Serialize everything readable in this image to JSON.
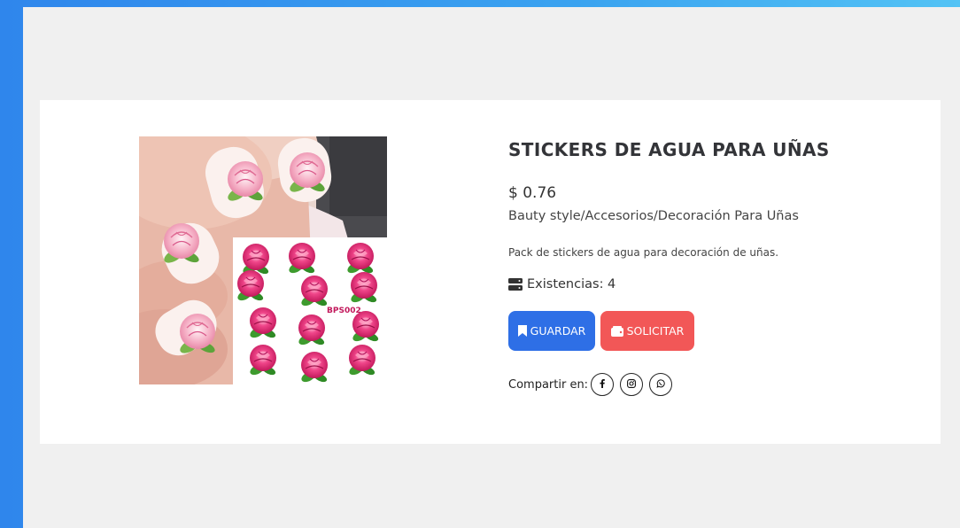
{
  "product": {
    "title": "STICKERS DE AGUA PARA UÑAS",
    "price": "$ 0.76",
    "breadcrumb": "Bauty style/Accesorios/Decoración Para Uñas",
    "description": "Pack de stickers de agua para decoración de uñas.",
    "stock_label": "Existencias: 4",
    "image_text": "BPS002"
  },
  "actions": {
    "save_label": "GUARDAR",
    "request_label": "SOLICITAR"
  },
  "share": {
    "label": "Compartir en:",
    "networks": [
      "facebook-icon",
      "instagram-icon",
      "whatsapp-icon"
    ]
  },
  "colors": {
    "save_button": "#2e6fe6",
    "request_button": "#f25757",
    "background": "#f0f0f0",
    "frame_gradient": "#2f86ec"
  }
}
